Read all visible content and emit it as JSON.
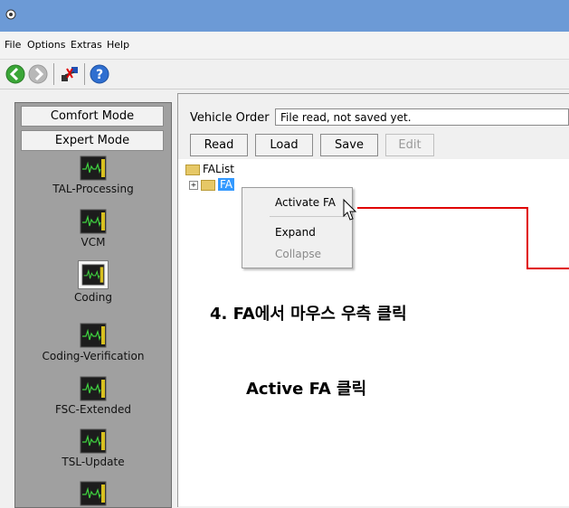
{
  "menu": {
    "file": "File",
    "options": "Options",
    "extras": "Extras",
    "help": "Help"
  },
  "toolbar": {
    "icons": [
      "back-icon",
      "forward-icon",
      "connect-icon",
      "help-icon"
    ]
  },
  "sidebar": {
    "mode_buttons": [
      "Comfort Mode",
      "Expert Mode"
    ],
    "items": [
      {
        "label": "TAL-Processing"
      },
      {
        "label": "VCM"
      },
      {
        "label": "Coding"
      },
      {
        "label": "Coding-Verification"
      },
      {
        "label": "FSC-Extended"
      },
      {
        "label": "TSL-Update"
      }
    ],
    "selected": "Coding"
  },
  "vehicle_order": {
    "label": "Vehicle Order",
    "value": "File read, not saved yet."
  },
  "buttons": {
    "read": "Read",
    "load": "Load",
    "save": "Save",
    "edit": "Edit"
  },
  "tree": {
    "root": "FAList",
    "child": "FA"
  },
  "context_menu": {
    "activate": "Activate FA",
    "expand": "Expand",
    "collapse": "Collapse"
  },
  "annotations": {
    "step4": "4. FA에서 마우스 우측 클릭",
    "active": "Active FA 클릭"
  },
  "colors": {
    "titlebar": "#6c9ad6",
    "annotation_line": "#e00000",
    "selection": "#3399ff"
  }
}
